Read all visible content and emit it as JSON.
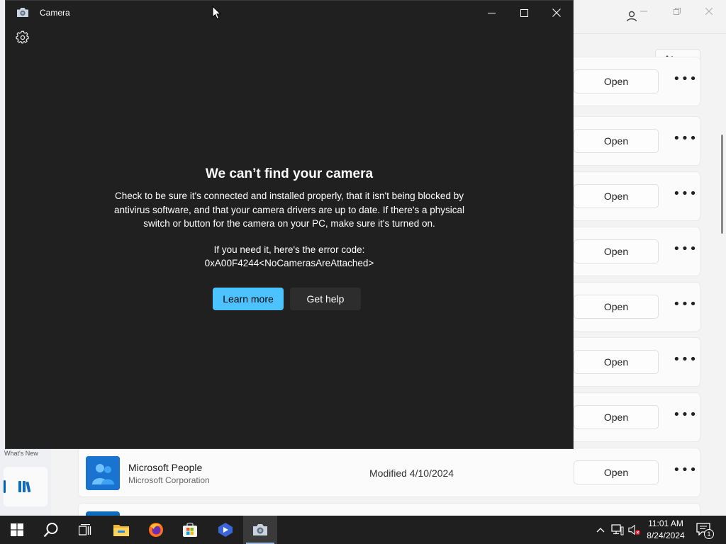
{
  "store": {
    "whats_new_label": "What's New",
    "rows": [
      {
        "open_label": "Open",
        "more_label": "•••"
      },
      {
        "open_label": "Open",
        "more_label": "•••"
      },
      {
        "open_label": "Open",
        "more_label": "•••"
      },
      {
        "open_label": "Open",
        "more_label": "•••"
      },
      {
        "open_label": "Open",
        "more_label": "•••"
      },
      {
        "open_label": "Open",
        "more_label": "•••"
      },
      {
        "open_label": "Open",
        "more_label": "•••"
      },
      {
        "name": "Microsoft People",
        "publisher": "Microsoft Corporation",
        "modified": "Modified 4/10/2024",
        "open_label": "Open",
        "more_label": "•••"
      }
    ],
    "accent_color": "#005fb8"
  },
  "camera": {
    "title": "Camera",
    "heading": "We can’t find your camera",
    "body": "Check to be sure it's connected and installed properly, that it isn't being blocked by antivirus software, and that your camera drivers are up to date. If there's a physical switch or button for the camera on your PC, make sure it's turned on.",
    "error_label": "If you need it, here's the error code:",
    "error_code": "0xA00F4244<NoCamerasAreAttached>",
    "learn_more_label": "Learn more",
    "get_help_label": "Get help",
    "accent_color": "#4cc2ff"
  },
  "taskbar": {
    "apps": [
      "start-icon",
      "search-icon",
      "task-view-icon",
      "file-explorer-icon",
      "firefox-icon",
      "microsoft-store-icon",
      "media-app-icon",
      "camera-app-icon"
    ],
    "time": "11:01 AM",
    "date": "8/24/2024",
    "notification_count": "1"
  }
}
